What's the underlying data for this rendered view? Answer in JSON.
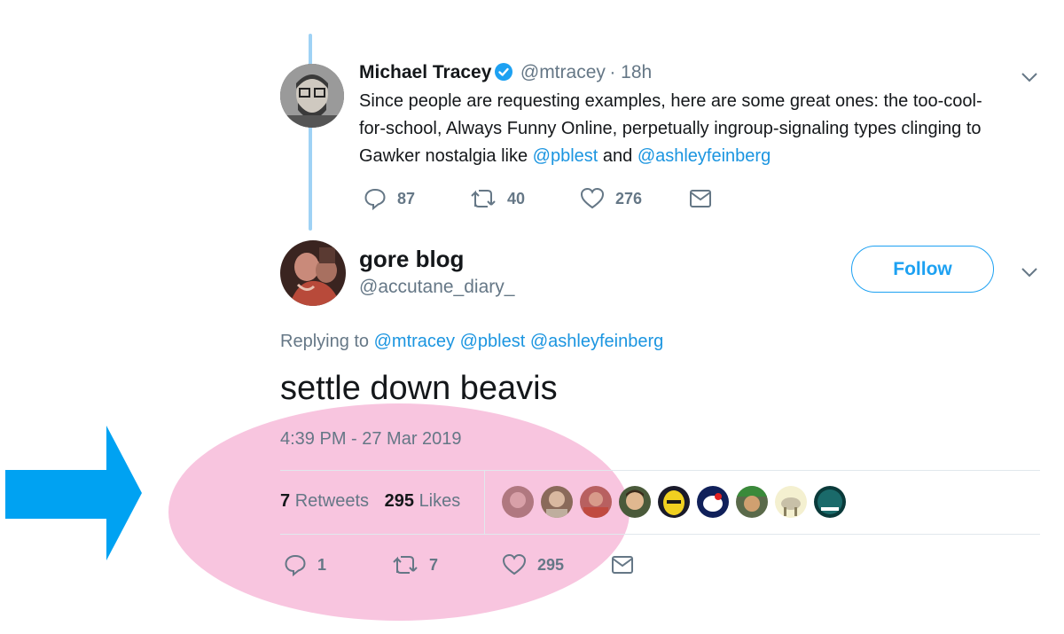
{
  "parent_tweet": {
    "name": "Michael Tracey",
    "handle": "@mtracey",
    "time": "· 18h",
    "text_parts": [
      "Since people are requesting examples, here are some great ones: the too-cool-",
      "for-school, Always Funny Online, perpetually ingroup-signaling types clinging to",
      "Gawker nostalgia like "
    ],
    "mention1": "@pblest",
    "and_text": " and ",
    "mention2": "@ashleyfeinberg",
    "replies": "87",
    "retweets": "40",
    "likes": "276"
  },
  "main_tweet": {
    "name": "gore blog",
    "handle": "@accutane_diary_",
    "follow_label": "Follow",
    "replying_prefix": "Replying to",
    "replying_to": [
      "@mtracey",
      "@pblest",
      "@ashleyfeinberg"
    ],
    "text": "settle down beavis",
    "timestamp": "4:39 PM - 27 Mar 2019",
    "retweets_count": "7",
    "retweets_label": "Retweets",
    "likes_count": "295",
    "likes_label": "Likes",
    "action_replies": "1",
    "action_retweets": "7",
    "action_likes": "295"
  },
  "annotation": {
    "arrow_color": "#00a2f2",
    "highlight_color": "#f5b3d7"
  },
  "likers": [
    "avatar",
    "avatar",
    "avatar",
    "avatar",
    "avatar",
    "avatar",
    "avatar",
    "avatar",
    "avatar"
  ]
}
